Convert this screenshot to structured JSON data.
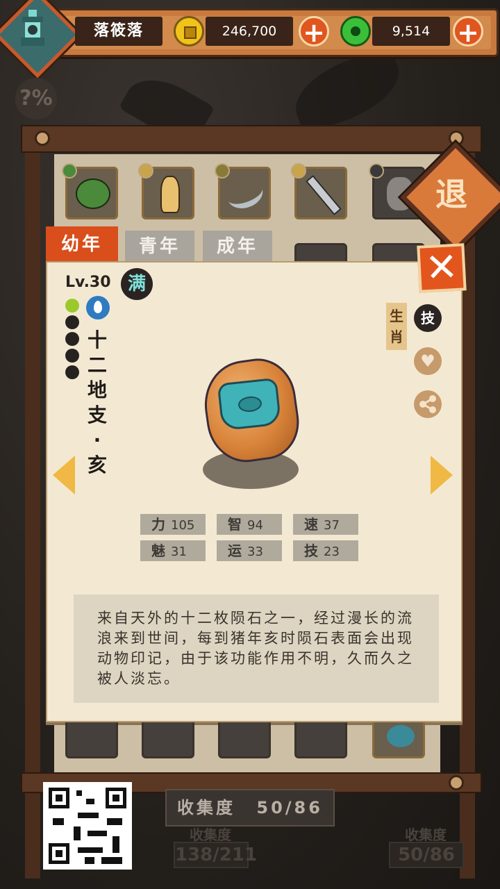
{
  "player": {
    "name": "落筱落"
  },
  "resources": {
    "coins": "246,700",
    "jade": "9,514"
  },
  "help_label": "?%",
  "retreat_label": "退",
  "tabs": [
    {
      "label": "幼年",
      "active": true
    },
    {
      "label": "青年",
      "active": false
    },
    {
      "label": "成年",
      "active": false
    }
  ],
  "card": {
    "level": "Lv.30",
    "full_badge": "满",
    "stars_filled": 1,
    "stars_total": 5,
    "element": "water",
    "name_chars": [
      "十",
      "二",
      "地",
      "支",
      "·",
      "亥"
    ],
    "tag_label": "生肖",
    "skill_label": "技",
    "stats": [
      {
        "key": "力",
        "value": "105"
      },
      {
        "key": "智",
        "value": "94"
      },
      {
        "key": "速",
        "value": "37"
      },
      {
        "key": "魅",
        "value": "31"
      },
      {
        "key": "运",
        "value": "33"
      },
      {
        "key": "技",
        "value": "23"
      }
    ],
    "description": "来自天外的十二枚陨石之一，经过漫长的流浪来到世间，每到猪年亥时陨石表面会出现动物印记，由于该功能作用不明，久而久之被人淡忘。"
  },
  "close_label": "✕",
  "collection": {
    "label": "收集度",
    "value": "50/86"
  },
  "background_collections": [
    {
      "label": "收集度",
      "value": "138/211"
    },
    {
      "label": "收集度",
      "value": "50/86"
    }
  ],
  "colors": {
    "accent": "#d94e1a",
    "card": "#f3e9d2",
    "frame": "#4a2d1c"
  }
}
